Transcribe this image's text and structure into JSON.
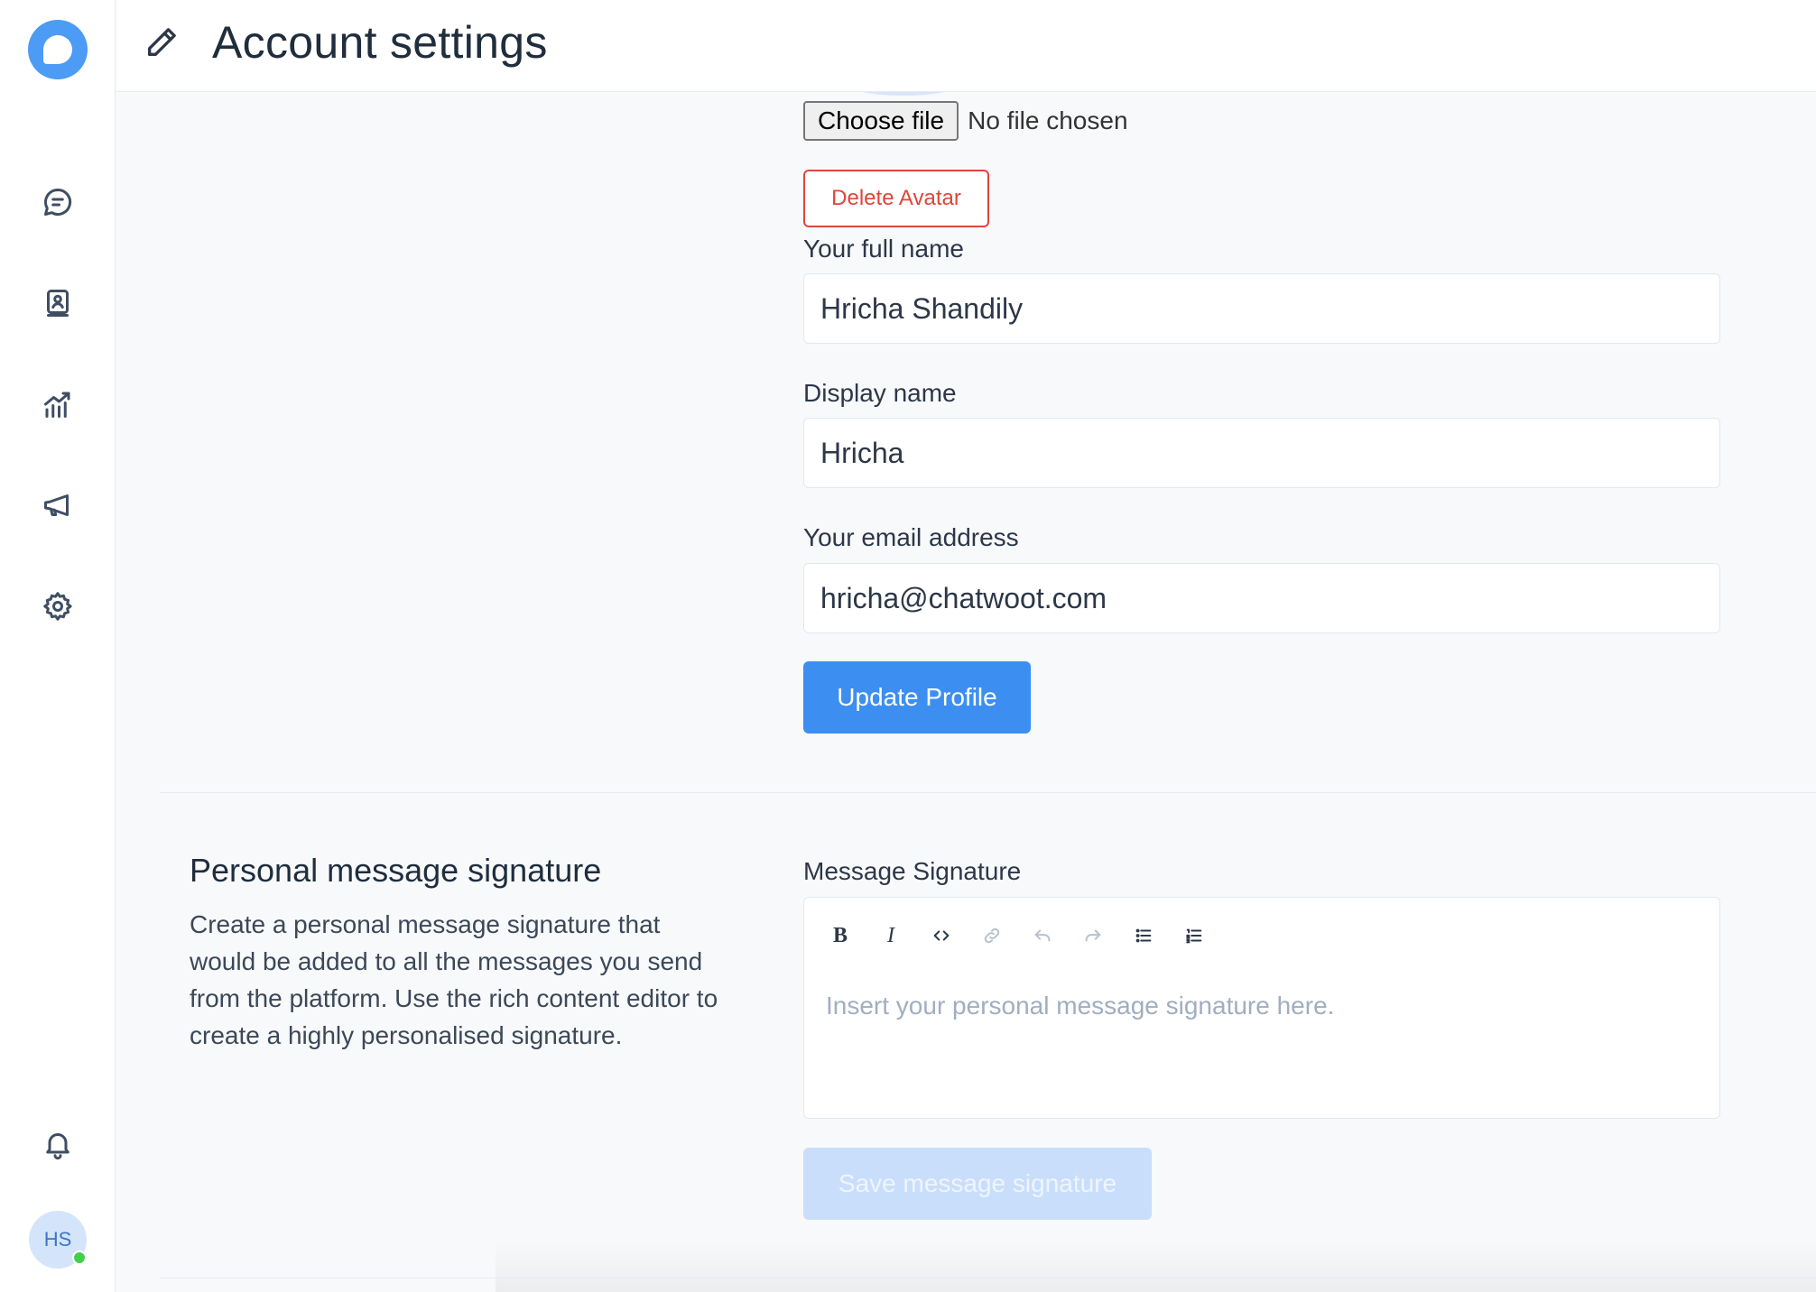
{
  "header": {
    "title": "Account settings"
  },
  "sidebar": {
    "items": [
      {
        "name": "conversations",
        "icon": "chat-bubble-icon"
      },
      {
        "name": "contacts",
        "icon": "contact-book-icon"
      },
      {
        "name": "reports",
        "icon": "chart-icon"
      },
      {
        "name": "campaigns",
        "icon": "megaphone-icon"
      },
      {
        "name": "settings",
        "icon": "gear-icon"
      }
    ],
    "notifications_icon": "bell-icon",
    "avatar_initials": "HS"
  },
  "profile": {
    "file_button": "Choose file",
    "file_status": "No file chosen",
    "delete_avatar": "Delete Avatar",
    "full_name_label": "Your full name",
    "full_name_value": "Hricha Shandily",
    "display_name_label": "Display name",
    "display_name_value": "Hricha",
    "email_label": "Your email address",
    "email_value": "hricha@chatwoot.com",
    "update_button": "Update Profile"
  },
  "signature": {
    "title": "Personal message signature",
    "description": "Create a personal message signature that would be added to all the messages you send from the platform. Use the rich content editor to create a highly personalised signature.",
    "field_label": "Message Signature",
    "placeholder": "Insert your personal message signature here.",
    "save_button": "Save message signature",
    "toolbar": {
      "bold": "B",
      "italic": "I"
    }
  },
  "colors": {
    "primary": "#3c8ef1",
    "danger": "#e0453a",
    "online": "#44ce4b"
  }
}
